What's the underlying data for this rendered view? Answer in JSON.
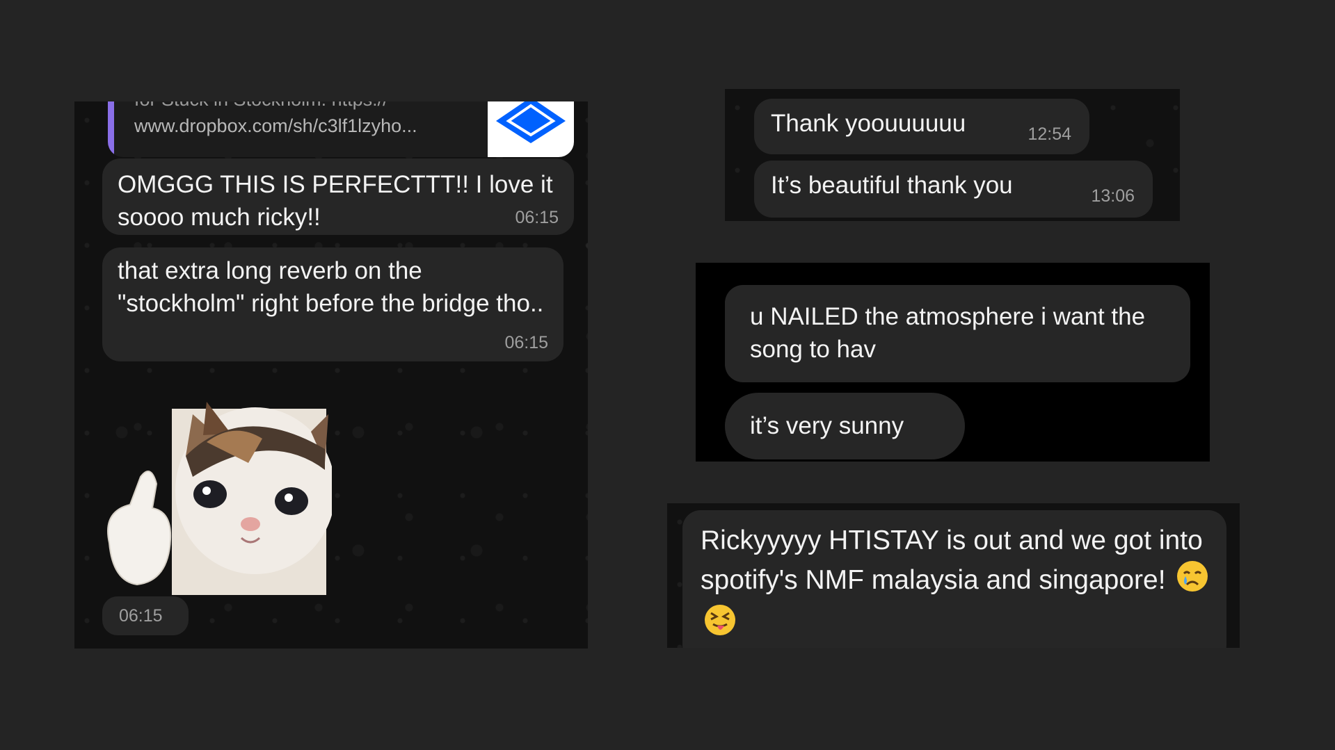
{
  "panel1": {
    "link_preview": {
      "cut_text": "for Stuck in Stockholm: https://",
      "url": "www.dropbox.com/sh/c3lf1lzyho..."
    },
    "messages": [
      {
        "text": "OMGGG THIS IS PERFECTTT!! I love it soooo much ricky!!",
        "time": "06:15"
      },
      {
        "text": "that extra long reverb on the \"stockholm\" right before the bridge tho..",
        "time": "06:15"
      }
    ],
    "sticker_time": "06:15"
  },
  "panel2": {
    "messages": [
      {
        "text": "Thank yoouuuuuu",
        "time": "12:54"
      },
      {
        "text": "It’s beautiful thank you",
        "time": "13:06"
      }
    ]
  },
  "panel3": {
    "messages": [
      {
        "text": "u NAILED the atmosphere i want the song to hav"
      },
      {
        "text": "it’s very sunny"
      }
    ]
  },
  "panel4": {
    "message": {
      "text": "Rickyyyyy HTISTAY is out and we got into spotify's NMF malaysia and singapore!"
    },
    "emojis": [
      "crying-face-emoji",
      "squinting-tongue-face-emoji"
    ]
  },
  "colors": {
    "page_background": "#242424",
    "bubble": "#262626",
    "wallpaper": "#111111",
    "link_accent": "#8a6fe8",
    "dropbox_blue": "#0061fe"
  }
}
